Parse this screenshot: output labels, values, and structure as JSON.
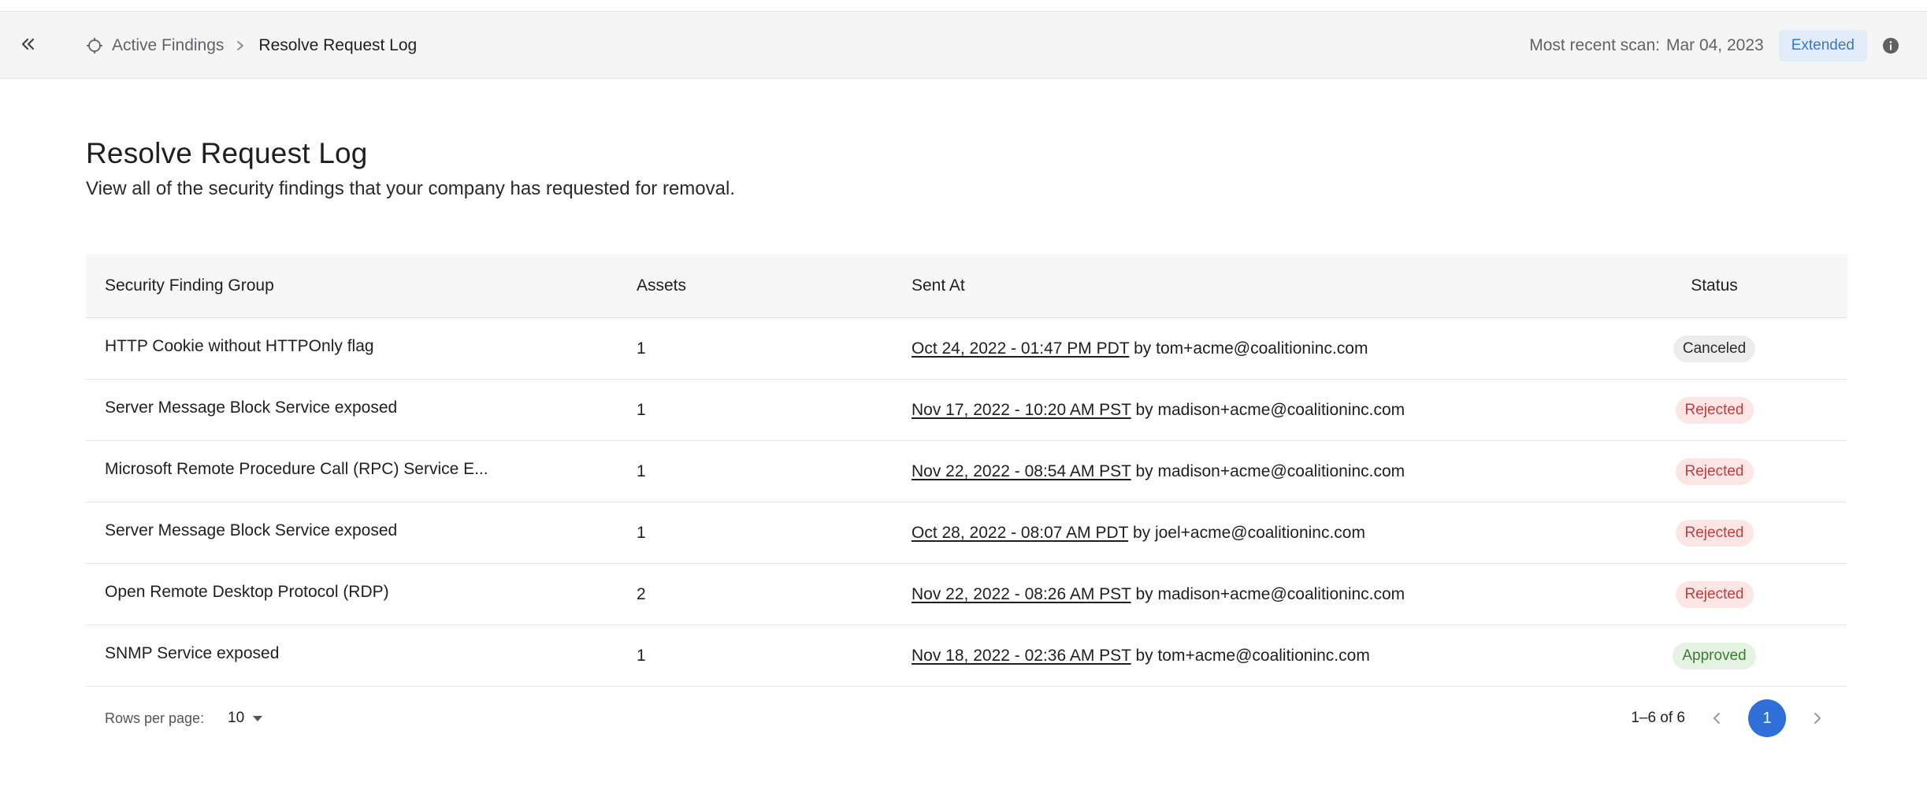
{
  "header": {
    "breadcrumb_root": "Active Findings",
    "breadcrumb_current": "Resolve Request Log",
    "scan_label": "Most recent scan:",
    "scan_date": "Mar 04, 2023",
    "scan_badge": "Extended",
    "icons": [
      "collapse-sidebar-icon",
      "crosshair-icon",
      "chevron-right-icon",
      "info-icon"
    ]
  },
  "page": {
    "title": "Resolve Request Log",
    "subtitle": "View all of the security findings that your company has requested for removal."
  },
  "table": {
    "columns": [
      "Security Finding Group",
      "Assets",
      "Sent At",
      "Status"
    ],
    "rows": [
      {
        "group": "HTTP Cookie without HTTPOnly flag",
        "assets": "1",
        "sent_at": "Oct 24, 2022 - 01:47 PM PDT",
        "by": "by tom+acme@coalitioninc.com",
        "status": "Canceled",
        "status_type": "canceled"
      },
      {
        "group": "Server Message Block Service exposed",
        "assets": "1",
        "sent_at": "Nov 17, 2022 - 10:20 AM PST",
        "by": "by madison+acme@coalitioninc.com",
        "status": "Rejected",
        "status_type": "rejected"
      },
      {
        "group": "Microsoft Remote Procedure Call (RPC) Service E...",
        "assets": "1",
        "sent_at": "Nov 22, 2022 - 08:54 AM PST",
        "by": "by madison+acme@coalitioninc.com",
        "status": "Rejected",
        "status_type": "rejected"
      },
      {
        "group": "Server Message Block Service exposed",
        "assets": "1",
        "sent_at": "Oct 28, 2022 - 08:07 AM PDT",
        "by": "by joel+acme@coalitioninc.com",
        "status": "Rejected",
        "status_type": "rejected"
      },
      {
        "group": "Open Remote Desktop Protocol (RDP)",
        "assets": "2",
        "sent_at": "Nov 22, 2022 - 08:26 AM PST",
        "by": "by madison+acme@coalitioninc.com",
        "status": "Rejected",
        "status_type": "rejected"
      },
      {
        "group": "SNMP Service exposed",
        "assets": "1",
        "sent_at": "Nov 18, 2022 - 02:36 AM PST",
        "by": "by tom+acme@coalitioninc.com",
        "status": "Approved",
        "status_type": "approved"
      }
    ]
  },
  "pagination": {
    "rows_per_page_label": "Rows per page:",
    "rows_per_page_value": "10",
    "range": "1–6 of 6",
    "current_page": "1"
  },
  "colors": {
    "accent": "#2e6fd8",
    "badge_bg": "#e3edf9",
    "rejected": "#c43b3b",
    "approved": "#3d7a34"
  }
}
